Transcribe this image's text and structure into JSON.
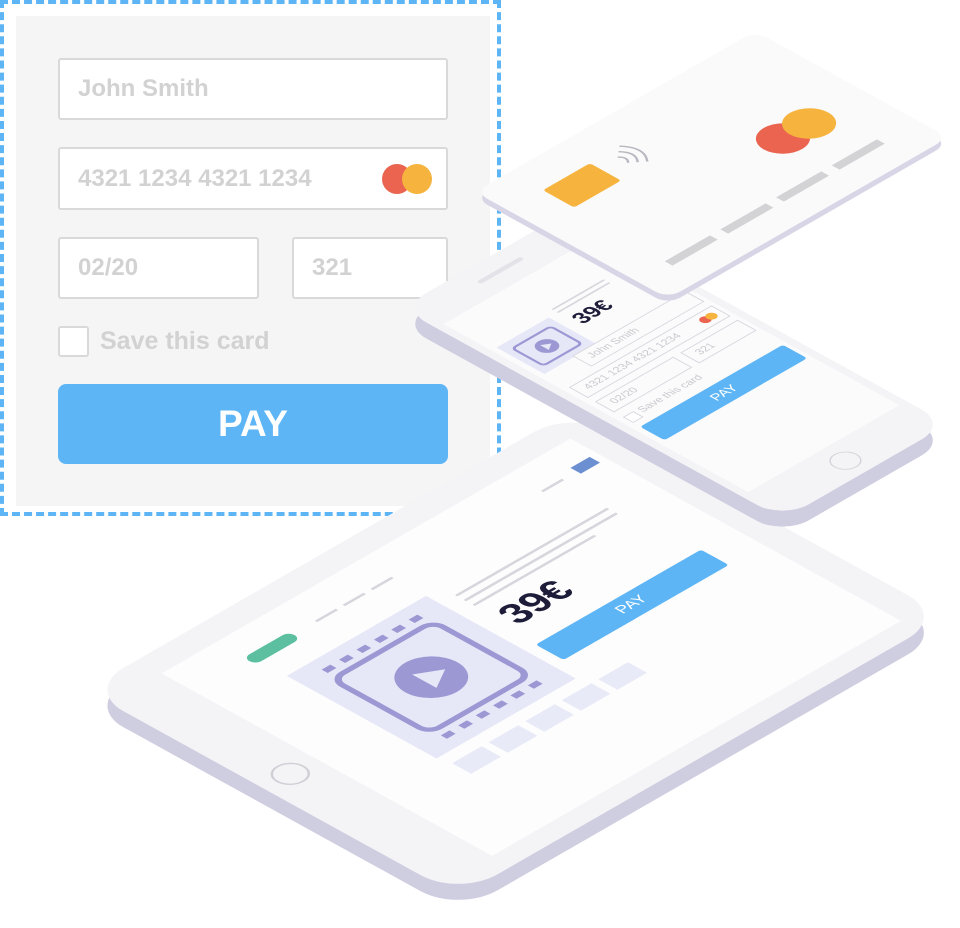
{
  "form": {
    "name_value": "John Smith",
    "card_number_value": "4321 1234 4321 1234",
    "expiry_value": "02/20",
    "cvv_value": "321",
    "save_card_label": "Save this card",
    "save_card_checked": false,
    "pay_label": "PAY"
  },
  "tablet": {
    "price": "39€",
    "pay_label": "PAY"
  },
  "phone": {
    "price": "39€",
    "name_value": "John Smith",
    "card_number_value": "4321 1234 4321 1234",
    "expiry_value": "02/20",
    "cvv_value": "321",
    "save_card_label": "Save this card",
    "pay_label": "PAY"
  },
  "colors": {
    "accent": "#5eb5f5",
    "mastercard_red": "#ea6450",
    "mastercard_yellow": "#f6b43f",
    "chip": "#f6b43f",
    "pill_green": "#5bbfa0",
    "video_icon": "#9b98d4"
  },
  "icons": [
    "mastercard-icon",
    "video-play-icon",
    "contactless-icon",
    "card-chip-icon",
    "home-button-icon"
  ]
}
